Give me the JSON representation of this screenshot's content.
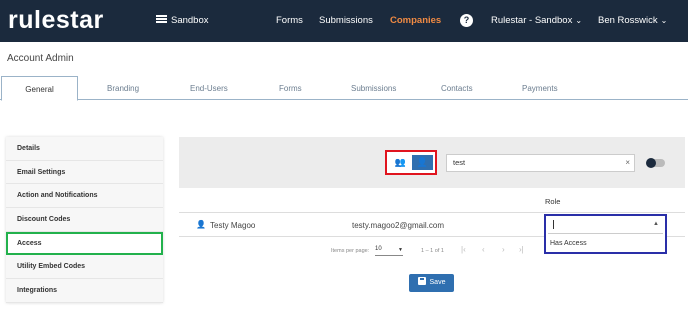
{
  "topnav": {
    "logo": "rulestar",
    "sandbox": "Sandbox",
    "items": [
      "Forms",
      "Submissions",
      "Companies"
    ],
    "help": "?",
    "org": "Rulestar - Sandbox",
    "user": "Ben Rosswick"
  },
  "page": {
    "title": "Account Admin"
  },
  "tabs": [
    "General",
    "Branding",
    "End-Users",
    "Forms",
    "Submissions",
    "Contacts",
    "Payments"
  ],
  "sidebar": [
    "Details",
    "Email Settings",
    "Action and Notifications",
    "Discount Codes",
    "Access",
    "Utility Embed Codes",
    "Integrations"
  ],
  "search": {
    "value": "test",
    "clear": "×"
  },
  "table": {
    "role_header": "Role",
    "rows": [
      {
        "name": "Testy Magoo",
        "email": "testy.magoo2@gmail.com"
      }
    ],
    "role_option": "Has Access"
  },
  "pagination": {
    "items_per_page_label": "Items per page:",
    "per_page": "10",
    "range": "1 – 1 of 1"
  },
  "save_label": "Save",
  "colors": {
    "nav_bg": "#1b2a3d",
    "accent": "#f08a43",
    "primary": "#2f6fb0"
  }
}
